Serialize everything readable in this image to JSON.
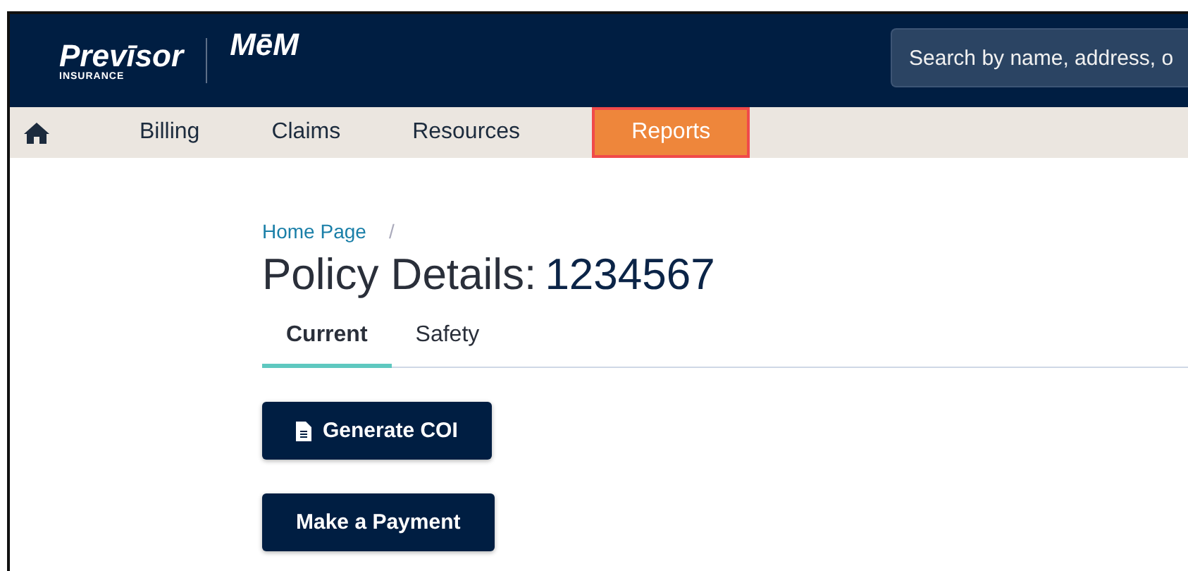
{
  "header": {
    "brand": {
      "name": "Prevīsor",
      "tagline": "INSURANCE",
      "partner": "MēM"
    },
    "search": {
      "placeholder": "Search by name, address, o"
    }
  },
  "nav": {
    "items": [
      {
        "kind": "home",
        "selected": false
      },
      {
        "kind": "link",
        "label": "Billing",
        "selected": false
      },
      {
        "kind": "link",
        "label": "Claims",
        "selected": false
      },
      {
        "kind": "link",
        "label": "Resources",
        "selected": false
      },
      {
        "kind": "link",
        "label": "Reports",
        "selected": true
      }
    ]
  },
  "breadcrumb": [
    "Home Page",
    "/"
  ],
  "title": {
    "label": "Policy Details:",
    "number": "1234567"
  },
  "tabs": [
    {
      "label": "Current",
      "selected": true
    },
    {
      "label": "Safety",
      "selected": false
    }
  ],
  "buttons": [
    {
      "kind": "document",
      "label": "Generate COI"
    },
    {
      "kind": "plain",
      "label": "Make a Payment"
    }
  ]
}
